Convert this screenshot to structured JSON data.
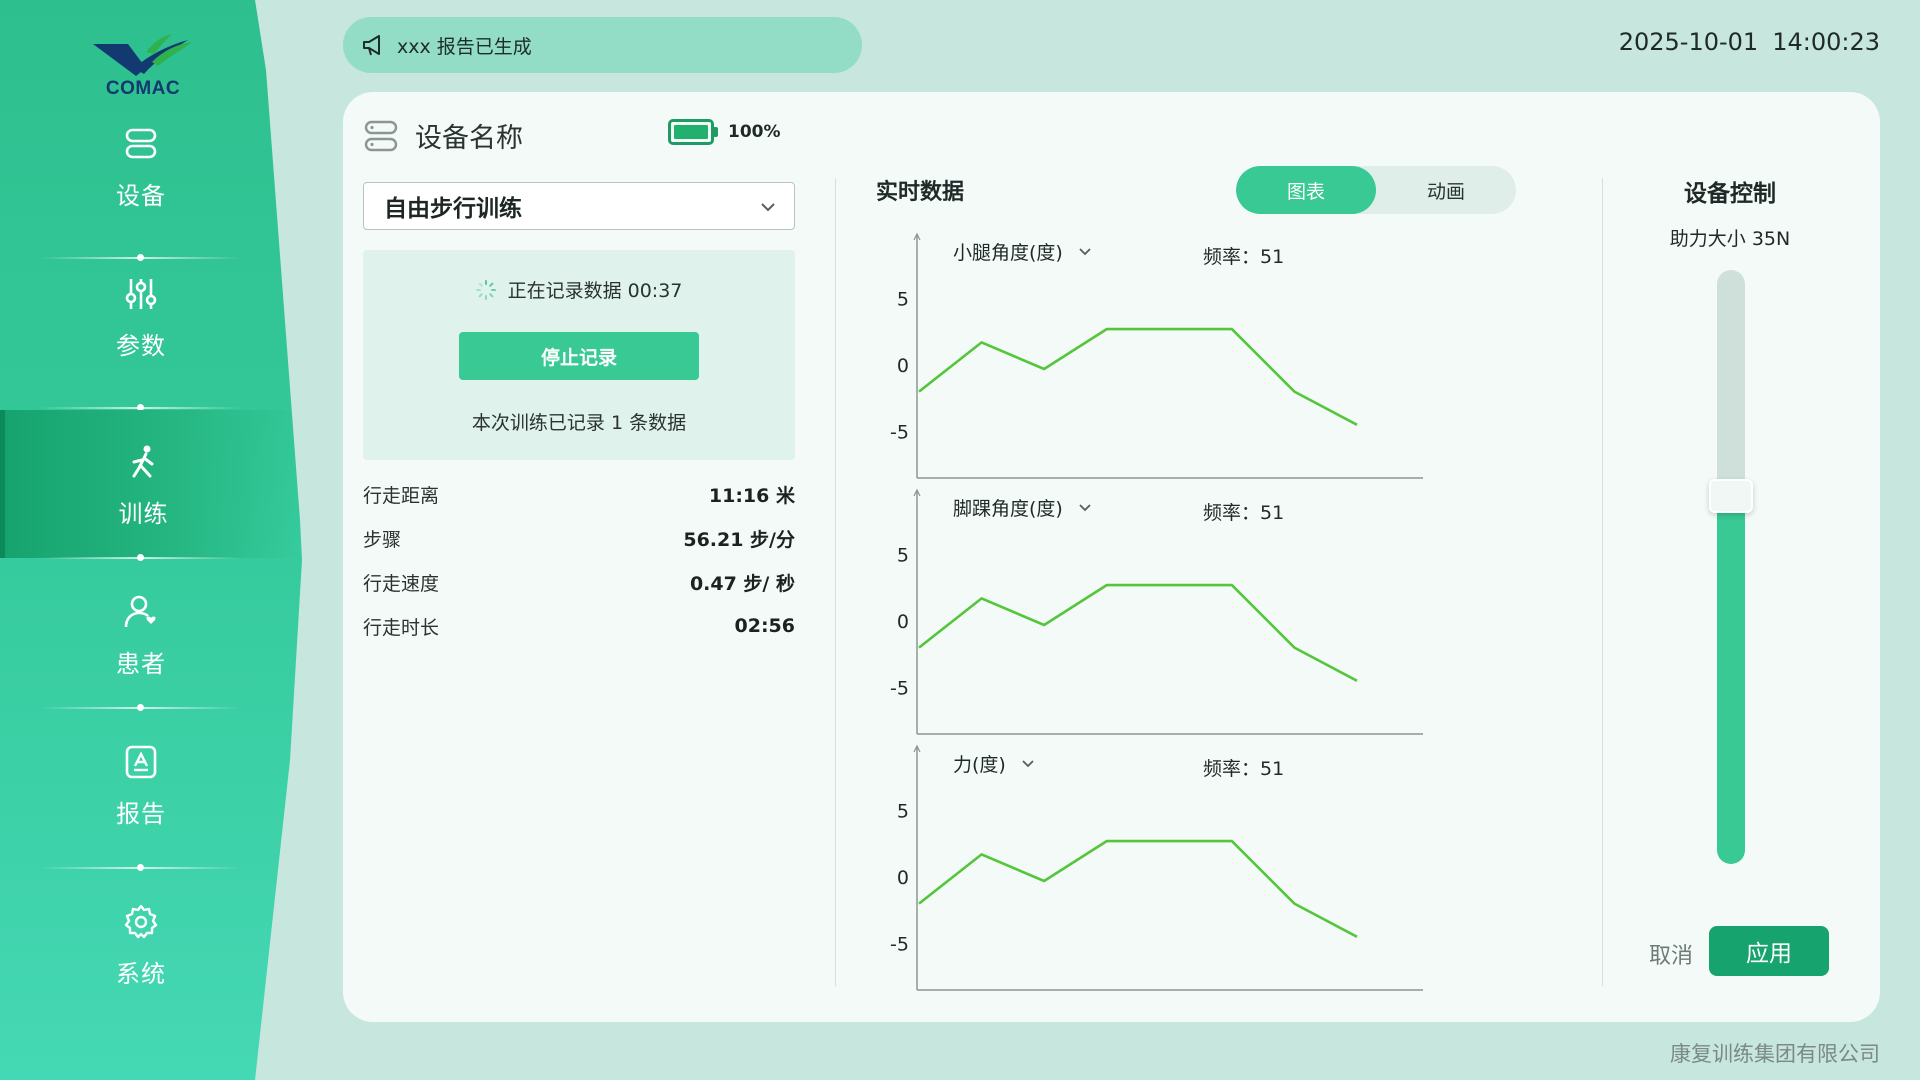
{
  "sidebar": {
    "logo_text": "COMAC",
    "items": [
      {
        "label": "设备",
        "icon": "device-icon"
      },
      {
        "label": "参数",
        "icon": "sliders-icon"
      },
      {
        "label": "训练",
        "icon": "walking-icon",
        "active": true
      },
      {
        "label": "患者",
        "icon": "patient-icon"
      },
      {
        "label": "报告",
        "icon": "report-icon"
      },
      {
        "label": "系统",
        "icon": "gear-icon"
      }
    ]
  },
  "notification": {
    "text": "xxx  报告已生成",
    "icon": "megaphone-icon"
  },
  "datetime": {
    "date": "2025-10-01",
    "time": "14:00:23"
  },
  "device": {
    "title": "设备名称",
    "battery": "100%",
    "battery_level": 1.0
  },
  "training": {
    "mode": "自由步行训练",
    "recording_status": "正在记录数据 00:37",
    "stop_label": "停止记录",
    "recorded_count": "本次训练已记录 1 条数据"
  },
  "stats": [
    {
      "label": "行走距离",
      "value": "11:16 米"
    },
    {
      "label": "步骤",
      "value": "56.21 步/分"
    },
    {
      "label": "行走速度",
      "value": "0.47 步/ 秒"
    },
    {
      "label": "行走时长",
      "value": "02:56"
    }
  ],
  "realtime": {
    "title": "实时数据",
    "tabs": [
      {
        "label": "图表",
        "active": true
      },
      {
        "label": "动画",
        "active": false
      }
    ]
  },
  "control": {
    "title": "设备控制",
    "value_text": "助力大小 35N",
    "slider_fraction": 0.62,
    "cancel_label": "取消",
    "apply_label": "应用"
  },
  "colors": {
    "accent": "#38c995",
    "line": "#55c63b",
    "dark_green": "#16a36e"
  },
  "footer": "康复训练集团有限公司",
  "chart_data": [
    {
      "type": "line",
      "title": "小腿角度(度)",
      "frequency": "频率：51",
      "x": [
        0,
        1,
        2,
        3,
        4,
        5,
        6,
        7
      ],
      "values": [
        -2,
        1.7,
        -0.3,
        2.7,
        2.7,
        2.7,
        -2,
        -4.5
      ],
      "ylim": [
        -8.5,
        7
      ],
      "yticks": [
        "5",
        "0",
        "-5"
      ],
      "grid": false
    },
    {
      "type": "line",
      "title": "脚踝角度(度)",
      "frequency": "频率：51",
      "x": [
        0,
        1,
        2,
        3,
        4,
        5,
        6,
        7
      ],
      "values": [
        -2,
        1.7,
        -0.3,
        2.7,
        2.7,
        2.7,
        -2,
        -4.5
      ],
      "ylim": [
        -8.5,
        7
      ],
      "yticks": [
        "5",
        "0",
        "-5"
      ],
      "grid": false
    },
    {
      "type": "line",
      "title": "力(度)",
      "frequency": "频率：51",
      "x": [
        0,
        1,
        2,
        3,
        4,
        5,
        6,
        7
      ],
      "values": [
        -2,
        1.7,
        -0.3,
        2.7,
        2.7,
        2.7,
        -2,
        -4.5
      ],
      "ylim": [
        -8.5,
        7
      ],
      "yticks": [
        "5",
        "0",
        "-5"
      ],
      "grid": false
    }
  ]
}
